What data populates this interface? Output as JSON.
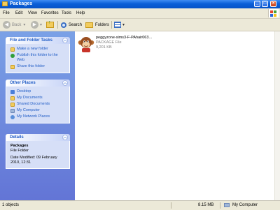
{
  "window": {
    "title": "Packages"
  },
  "menu": [
    "File",
    "Edit",
    "View",
    "Favorites",
    "Tools",
    "Help"
  ],
  "toolbar": {
    "back": "Back",
    "search": "Search",
    "folders": "Folders"
  },
  "tasks": {
    "title": "File and Folder Tasks",
    "items": [
      "Make a new folder",
      "Publish this folder to the Web",
      "Share this folder"
    ]
  },
  "places": {
    "title": "Other Places",
    "items": [
      "Desktop",
      "My Documents",
      "Shared Documents",
      "My Computer",
      "My Network Places"
    ]
  },
  "details": {
    "title": "Details",
    "name": "Packages",
    "type": "File Folder",
    "modified": "Date Modified: 09 February 2010, 12:31"
  },
  "file": {
    "name": "peggyzone-sims3-F-PAhair063...",
    "type": "PACKAGE File",
    "size": "9,201 KB",
    "icon": "monkey-icon"
  },
  "status": {
    "objects": "1 objects",
    "size": "8.15 MB",
    "location": "My Computer"
  }
}
